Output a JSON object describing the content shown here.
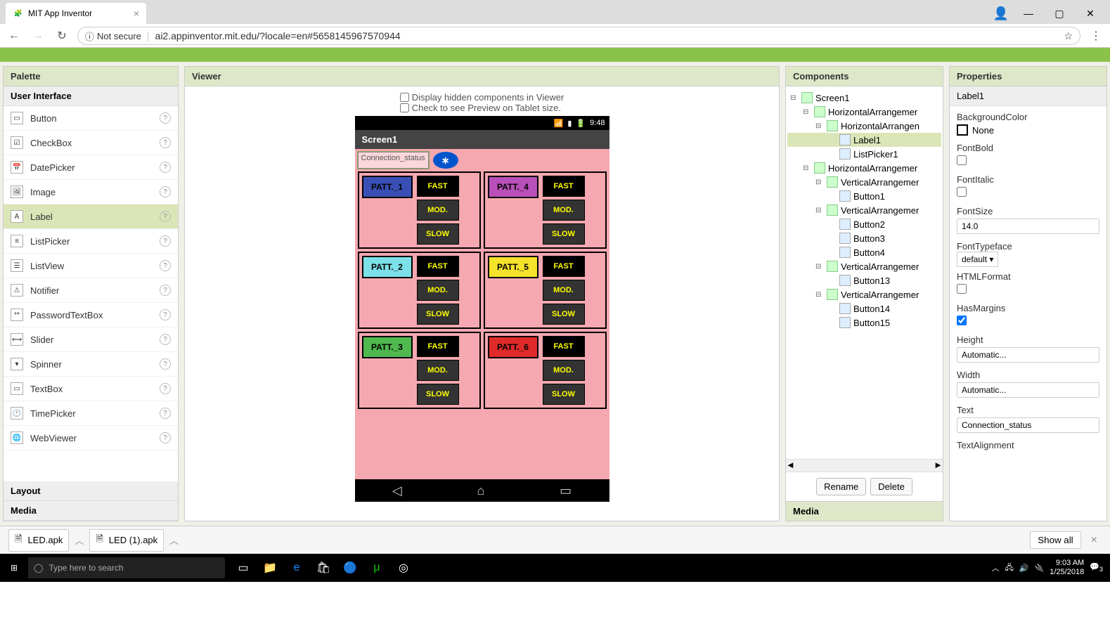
{
  "browser": {
    "tab_title": "MIT App Inventor",
    "security": "Not secure",
    "url": "ai2.appinventor.mit.edu/?locale=en#5658145967570944"
  },
  "palette": {
    "title": "Palette",
    "category": "User Interface",
    "items": [
      "Button",
      "CheckBox",
      "DatePicker",
      "Image",
      "Label",
      "ListPicker",
      "ListView",
      "Notifier",
      "PasswordTextBox",
      "Slider",
      "Spinner",
      "TextBox",
      "TimePicker",
      "WebViewer"
    ],
    "selected": "Label",
    "cat2": "Layout",
    "cat3": "Media"
  },
  "viewer": {
    "title": "Viewer",
    "opt1": "Display hidden components in Viewer",
    "opt2": "Check to see Preview on Tablet size.",
    "phone_time": "9:48",
    "screen_title": "Screen1",
    "conn_status": "Connection_status",
    "patterns": [
      {
        "label": "PATT._1",
        "bg": "#3a4fb5",
        "fg": "#000"
      },
      {
        "label": "PATT._4",
        "bg": "#b94fb9",
        "fg": "#000"
      },
      {
        "label": "PATT._2",
        "bg": "#7de0e8",
        "fg": "#000"
      },
      {
        "label": "PATT._5",
        "bg": "#f5e22a",
        "fg": "#000"
      },
      {
        "label": "PATT._3",
        "bg": "#4fb94f",
        "fg": "#000"
      },
      {
        "label": "PATT._6",
        "bg": "#e02a2a",
        "fg": "#000"
      }
    ],
    "speed_fast": "FAST",
    "speed_mod": "MOD.",
    "speed_slow": "SLOW"
  },
  "components": {
    "title": "Components",
    "tree": [
      {
        "depth": 0,
        "toggle": "⊟",
        "icon": "scr",
        "label": "Screen1"
      },
      {
        "depth": 1,
        "toggle": "⊟",
        "icon": "arr",
        "label": "HorizontalArrangemer"
      },
      {
        "depth": 2,
        "toggle": "⊟",
        "icon": "arr",
        "label": "HorizontalArrangen"
      },
      {
        "depth": 3,
        "toggle": "",
        "icon": "lbl",
        "label": "Label1",
        "selected": true
      },
      {
        "depth": 3,
        "toggle": "",
        "icon": "lst",
        "label": "ListPicker1"
      },
      {
        "depth": 1,
        "toggle": "⊟",
        "icon": "arr",
        "label": "HorizontalArrangemer"
      },
      {
        "depth": 2,
        "toggle": "⊟",
        "icon": "arr",
        "label": "VerticalArrangemer"
      },
      {
        "depth": 3,
        "toggle": "",
        "icon": "btn",
        "label": "Button1"
      },
      {
        "depth": 2,
        "toggle": "⊟",
        "icon": "arr",
        "label": "VerticalArrangemer"
      },
      {
        "depth": 3,
        "toggle": "",
        "icon": "btn",
        "label": "Button2"
      },
      {
        "depth": 3,
        "toggle": "",
        "icon": "btn",
        "label": "Button3"
      },
      {
        "depth": 3,
        "toggle": "",
        "icon": "btn",
        "label": "Button4"
      },
      {
        "depth": 2,
        "toggle": "⊟",
        "icon": "arr",
        "label": "VerticalArrangemer"
      },
      {
        "depth": 3,
        "toggle": "",
        "icon": "btn",
        "label": "Button13"
      },
      {
        "depth": 2,
        "toggle": "⊟",
        "icon": "arr",
        "label": "VerticalArrangemer"
      },
      {
        "depth": 3,
        "toggle": "",
        "icon": "btn",
        "label": "Button14"
      },
      {
        "depth": 3,
        "toggle": "",
        "icon": "btn",
        "label": "Button15"
      }
    ],
    "rename": "Rename",
    "delete": "Delete",
    "media": "Media"
  },
  "properties": {
    "title": "Properties",
    "component": "Label1",
    "bgcolor_label": "BackgroundColor",
    "bgcolor_value": "None",
    "fontbold": "FontBold",
    "fontitalic": "FontItalic",
    "fontsize_label": "FontSize",
    "fontsize_value": "14.0",
    "typeface_label": "FontTypeface",
    "typeface_value": "default",
    "htmlformat": "HTMLFormat",
    "hasmargins": "HasMargins",
    "height_label": "Height",
    "height_value": "Automatic...",
    "width_label": "Width",
    "width_value": "Automatic...",
    "text_label": "Text",
    "text_value": "Connection_status",
    "textalign": "TextAlignment"
  },
  "downloads": {
    "file1": "LED.apk",
    "file2": "LED (1).apk",
    "showall": "Show all"
  },
  "taskbar": {
    "search_placeholder": "Type here to search",
    "time": "9:03 AM",
    "date": "1/25/2018",
    "notif_count": "3"
  }
}
